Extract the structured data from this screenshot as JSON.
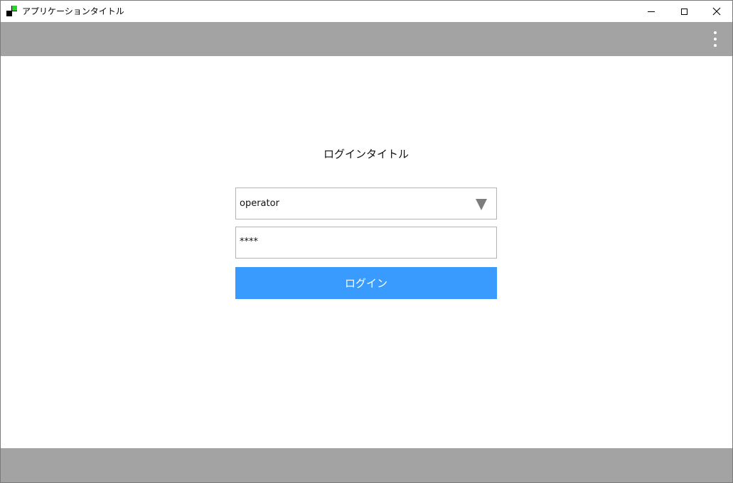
{
  "window": {
    "title": "アプリケーションタイトル",
    "icon": "app-icon"
  },
  "header": {
    "menu_icon": "kebab-menu-icon"
  },
  "login": {
    "title": "ログインタイトル",
    "user_select_value": "operator",
    "password_value": "****",
    "login_button_label": "ログイン"
  },
  "colors": {
    "header_bg": "#a3a3a3",
    "footer_bg": "#a3a3a3",
    "accent": "#3a9bff"
  }
}
